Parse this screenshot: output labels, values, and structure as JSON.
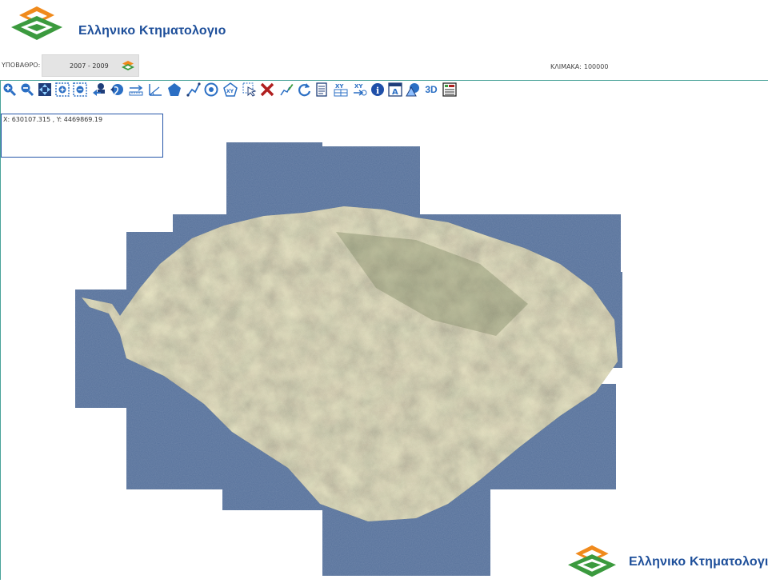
{
  "header": {
    "logo_text": "Ελληνικο Κτηματολογιο"
  },
  "basemap": {
    "label": "ΥΠΟΒΑΘΡΟ:",
    "value": "2007 - 2009",
    "icon": "layers-icon"
  },
  "scale": {
    "label": "ΚΛΙΜΑΚΑ:",
    "value": "100000"
  },
  "toolbar": {
    "tools": [
      "zoom-in-icon",
      "zoom-out-icon",
      "pan-icon",
      "zoom-box-in-icon",
      "zoom-box-out-icon",
      "previous-extent-icon",
      "full-extent-icon",
      "measure-distance-icon",
      "measure-angle-icon",
      "measure-area-icon",
      "draw-line-icon",
      "target-icon",
      "xy-polygon-icon",
      "select-icon",
      "clear-icon",
      "edit-line-icon",
      "refresh-icon",
      "document-icon",
      "xy-table-icon",
      "xy-goto-icon",
      "info-icon",
      "label-icon",
      "shapes-icon",
      "3d-label",
      "legend-icon"
    ],
    "label_3d": "3D"
  },
  "coords": {
    "text": "X: 630107.315 , Y: 4469869.19"
  },
  "footer": {
    "logo_text": "Ελληνικο Κτηματολογιο"
  },
  "colors": {
    "accent": "#4aa39a",
    "brand_blue": "#1e4f9a",
    "logo_orange": "#f08a1c",
    "logo_green": "#3b9a3e",
    "sea": "#5b76a0",
    "land": "#9d9478"
  }
}
